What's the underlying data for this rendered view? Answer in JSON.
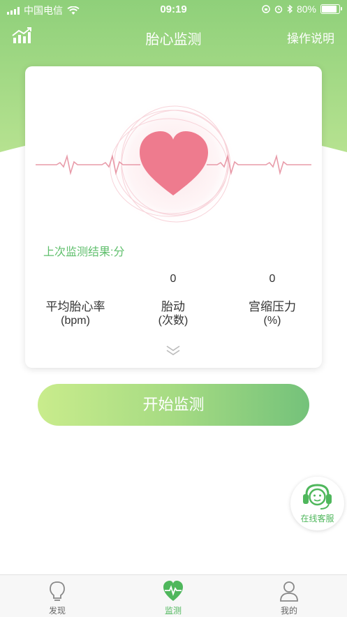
{
  "status_bar": {
    "carrier": "中国电信",
    "time": "09:19",
    "battery": "80%",
    "battery_level": 0.8
  },
  "navbar": {
    "title": "胎心监测",
    "help_label": "操作说明",
    "chart_icon": "trend-chart-icon"
  },
  "card": {
    "last_result": "上次监测结果:分",
    "stats": [
      {
        "value": "0",
        "label": "平均胎心率",
        "unit": "(bpm)"
      },
      {
        "value": "0",
        "label": "胎动",
        "unit": "(次数)"
      },
      {
        "value": "0",
        "label": "宫缩压力",
        "unit": "(%)"
      }
    ],
    "heart_icon": "heart-icon",
    "expand_icon": "double-chevron-down-icon"
  },
  "start_button": {
    "label": "开始监测"
  },
  "customer_service": {
    "label": "在线客服",
    "icon": "headset-icon"
  },
  "tabbar": {
    "items": [
      {
        "label": "发现",
        "icon": "lightbulb-icon",
        "active": false
      },
      {
        "label": "监测",
        "icon": "heart-pulse-icon",
        "active": true
      },
      {
        "label": "我的",
        "icon": "person-icon",
        "active": false
      }
    ]
  },
  "colors": {
    "brand_green": "#7cc86a",
    "heart_pink": "#ee7b8e",
    "accent_text_green": "#5fbf6c"
  }
}
